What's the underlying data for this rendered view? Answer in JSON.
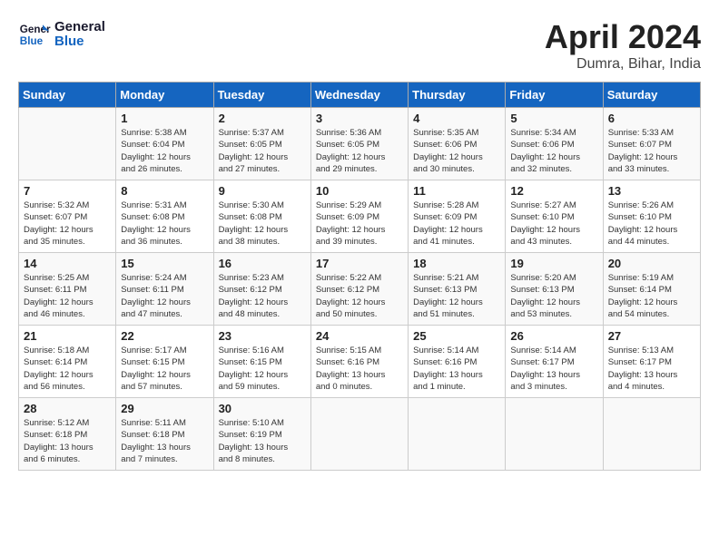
{
  "header": {
    "logo_line1": "General",
    "logo_line2": "Blue",
    "month": "April 2024",
    "location": "Dumra, Bihar, India"
  },
  "days_of_week": [
    "Sunday",
    "Monday",
    "Tuesday",
    "Wednesday",
    "Thursday",
    "Friday",
    "Saturday"
  ],
  "weeks": [
    [
      {
        "day": "",
        "info": ""
      },
      {
        "day": "1",
        "info": "Sunrise: 5:38 AM\nSunset: 6:04 PM\nDaylight: 12 hours\nand 26 minutes."
      },
      {
        "day": "2",
        "info": "Sunrise: 5:37 AM\nSunset: 6:05 PM\nDaylight: 12 hours\nand 27 minutes."
      },
      {
        "day": "3",
        "info": "Sunrise: 5:36 AM\nSunset: 6:05 PM\nDaylight: 12 hours\nand 29 minutes."
      },
      {
        "day": "4",
        "info": "Sunrise: 5:35 AM\nSunset: 6:06 PM\nDaylight: 12 hours\nand 30 minutes."
      },
      {
        "day": "5",
        "info": "Sunrise: 5:34 AM\nSunset: 6:06 PM\nDaylight: 12 hours\nand 32 minutes."
      },
      {
        "day": "6",
        "info": "Sunrise: 5:33 AM\nSunset: 6:07 PM\nDaylight: 12 hours\nand 33 minutes."
      }
    ],
    [
      {
        "day": "7",
        "info": "Sunrise: 5:32 AM\nSunset: 6:07 PM\nDaylight: 12 hours\nand 35 minutes."
      },
      {
        "day": "8",
        "info": "Sunrise: 5:31 AM\nSunset: 6:08 PM\nDaylight: 12 hours\nand 36 minutes."
      },
      {
        "day": "9",
        "info": "Sunrise: 5:30 AM\nSunset: 6:08 PM\nDaylight: 12 hours\nand 38 minutes."
      },
      {
        "day": "10",
        "info": "Sunrise: 5:29 AM\nSunset: 6:09 PM\nDaylight: 12 hours\nand 39 minutes."
      },
      {
        "day": "11",
        "info": "Sunrise: 5:28 AM\nSunset: 6:09 PM\nDaylight: 12 hours\nand 41 minutes."
      },
      {
        "day": "12",
        "info": "Sunrise: 5:27 AM\nSunset: 6:10 PM\nDaylight: 12 hours\nand 43 minutes."
      },
      {
        "day": "13",
        "info": "Sunrise: 5:26 AM\nSunset: 6:10 PM\nDaylight: 12 hours\nand 44 minutes."
      }
    ],
    [
      {
        "day": "14",
        "info": "Sunrise: 5:25 AM\nSunset: 6:11 PM\nDaylight: 12 hours\nand 46 minutes."
      },
      {
        "day": "15",
        "info": "Sunrise: 5:24 AM\nSunset: 6:11 PM\nDaylight: 12 hours\nand 47 minutes."
      },
      {
        "day": "16",
        "info": "Sunrise: 5:23 AM\nSunset: 6:12 PM\nDaylight: 12 hours\nand 48 minutes."
      },
      {
        "day": "17",
        "info": "Sunrise: 5:22 AM\nSunset: 6:12 PM\nDaylight: 12 hours\nand 50 minutes."
      },
      {
        "day": "18",
        "info": "Sunrise: 5:21 AM\nSunset: 6:13 PM\nDaylight: 12 hours\nand 51 minutes."
      },
      {
        "day": "19",
        "info": "Sunrise: 5:20 AM\nSunset: 6:13 PM\nDaylight: 12 hours\nand 53 minutes."
      },
      {
        "day": "20",
        "info": "Sunrise: 5:19 AM\nSunset: 6:14 PM\nDaylight: 12 hours\nand 54 minutes."
      }
    ],
    [
      {
        "day": "21",
        "info": "Sunrise: 5:18 AM\nSunset: 6:14 PM\nDaylight: 12 hours\nand 56 minutes."
      },
      {
        "day": "22",
        "info": "Sunrise: 5:17 AM\nSunset: 6:15 PM\nDaylight: 12 hours\nand 57 minutes."
      },
      {
        "day": "23",
        "info": "Sunrise: 5:16 AM\nSunset: 6:15 PM\nDaylight: 12 hours\nand 59 minutes."
      },
      {
        "day": "24",
        "info": "Sunrise: 5:15 AM\nSunset: 6:16 PM\nDaylight: 13 hours\nand 0 minutes."
      },
      {
        "day": "25",
        "info": "Sunrise: 5:14 AM\nSunset: 6:16 PM\nDaylight: 13 hours\nand 1 minute."
      },
      {
        "day": "26",
        "info": "Sunrise: 5:14 AM\nSunset: 6:17 PM\nDaylight: 13 hours\nand 3 minutes."
      },
      {
        "day": "27",
        "info": "Sunrise: 5:13 AM\nSunset: 6:17 PM\nDaylight: 13 hours\nand 4 minutes."
      }
    ],
    [
      {
        "day": "28",
        "info": "Sunrise: 5:12 AM\nSunset: 6:18 PM\nDaylight: 13 hours\nand 6 minutes."
      },
      {
        "day": "29",
        "info": "Sunrise: 5:11 AM\nSunset: 6:18 PM\nDaylight: 13 hours\nand 7 minutes."
      },
      {
        "day": "30",
        "info": "Sunrise: 5:10 AM\nSunset: 6:19 PM\nDaylight: 13 hours\nand 8 minutes."
      },
      {
        "day": "",
        "info": ""
      },
      {
        "day": "",
        "info": ""
      },
      {
        "day": "",
        "info": ""
      },
      {
        "day": "",
        "info": ""
      }
    ]
  ]
}
